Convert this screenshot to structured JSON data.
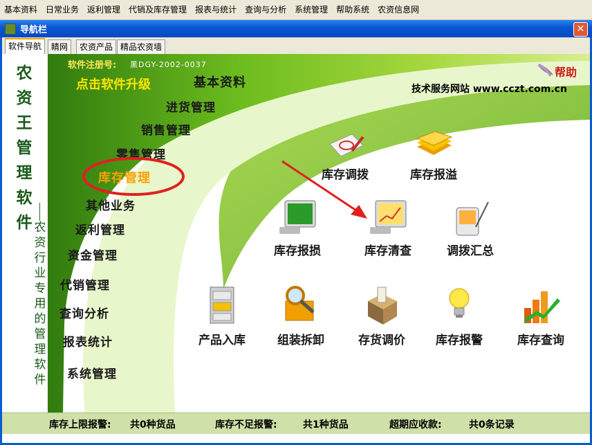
{
  "menu": [
    "基本资料",
    "日常业务",
    "返利管理",
    "代销及库存管理",
    "报表与统计",
    "查询与分析",
    "系统管理",
    "帮助系统",
    "农资信息网"
  ],
  "window": {
    "title": "导航栏",
    "close": "✕"
  },
  "tabs": [
    "软件导航",
    "睛网",
    "农资产品",
    "精品农资墙"
  ],
  "brand": {
    "name": "农资王管理软件",
    "subtitle": "农资行业专用的管理软件"
  },
  "registration": {
    "label": "软件注册号:",
    "number": "黑DGY-2002-0037"
  },
  "upgrade": "点击软件升级",
  "website": "技术服务网站 www.cczt.com.cn",
  "help": "帮助",
  "nav": [
    "基本资料",
    "进货管理",
    "销售管理",
    "零售管理",
    "库存管理",
    "其他业务",
    "返利管理",
    "资金管理",
    "代销管理",
    "查询分析",
    "报表统计",
    "系统管理"
  ],
  "functions": [
    "库存调拨",
    "库存报溢",
    "库存报损",
    "库存清查",
    "调拨汇总",
    "产品入库",
    "组装拆卸",
    "存货调价",
    "库存报警",
    "库存查询"
  ],
  "status": [
    "库存上限报警:",
    "共0种货品",
    "库存不足报警:",
    "共1种货品",
    "超期应收款:",
    "共0条记录"
  ],
  "colors": {
    "accent": "#f7a000",
    "brand_green": "#1a5a1a",
    "highlight": "#e02020"
  }
}
